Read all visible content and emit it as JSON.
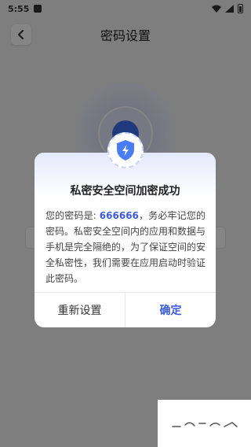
{
  "status_bar": {
    "time": "5:55"
  },
  "header": {
    "title": "密码设置"
  },
  "dialog": {
    "title": "私密安全空间加密成功",
    "message_prefix": "您的密码是: ",
    "code": "666666",
    "message_suffix": "，务必牢记您的密码。私密安全空间内的应用和数据与手机是完全隔绝的，为了保证空间的安全私密性，我们需要在应用启动时验证此密码。",
    "reset_label": "重新设置",
    "confirm_label": "确定",
    "badge_icon": "shield-lightning-icon"
  },
  "colors": {
    "accent": "#3d5bd9",
    "shield": "#4a7df5"
  }
}
